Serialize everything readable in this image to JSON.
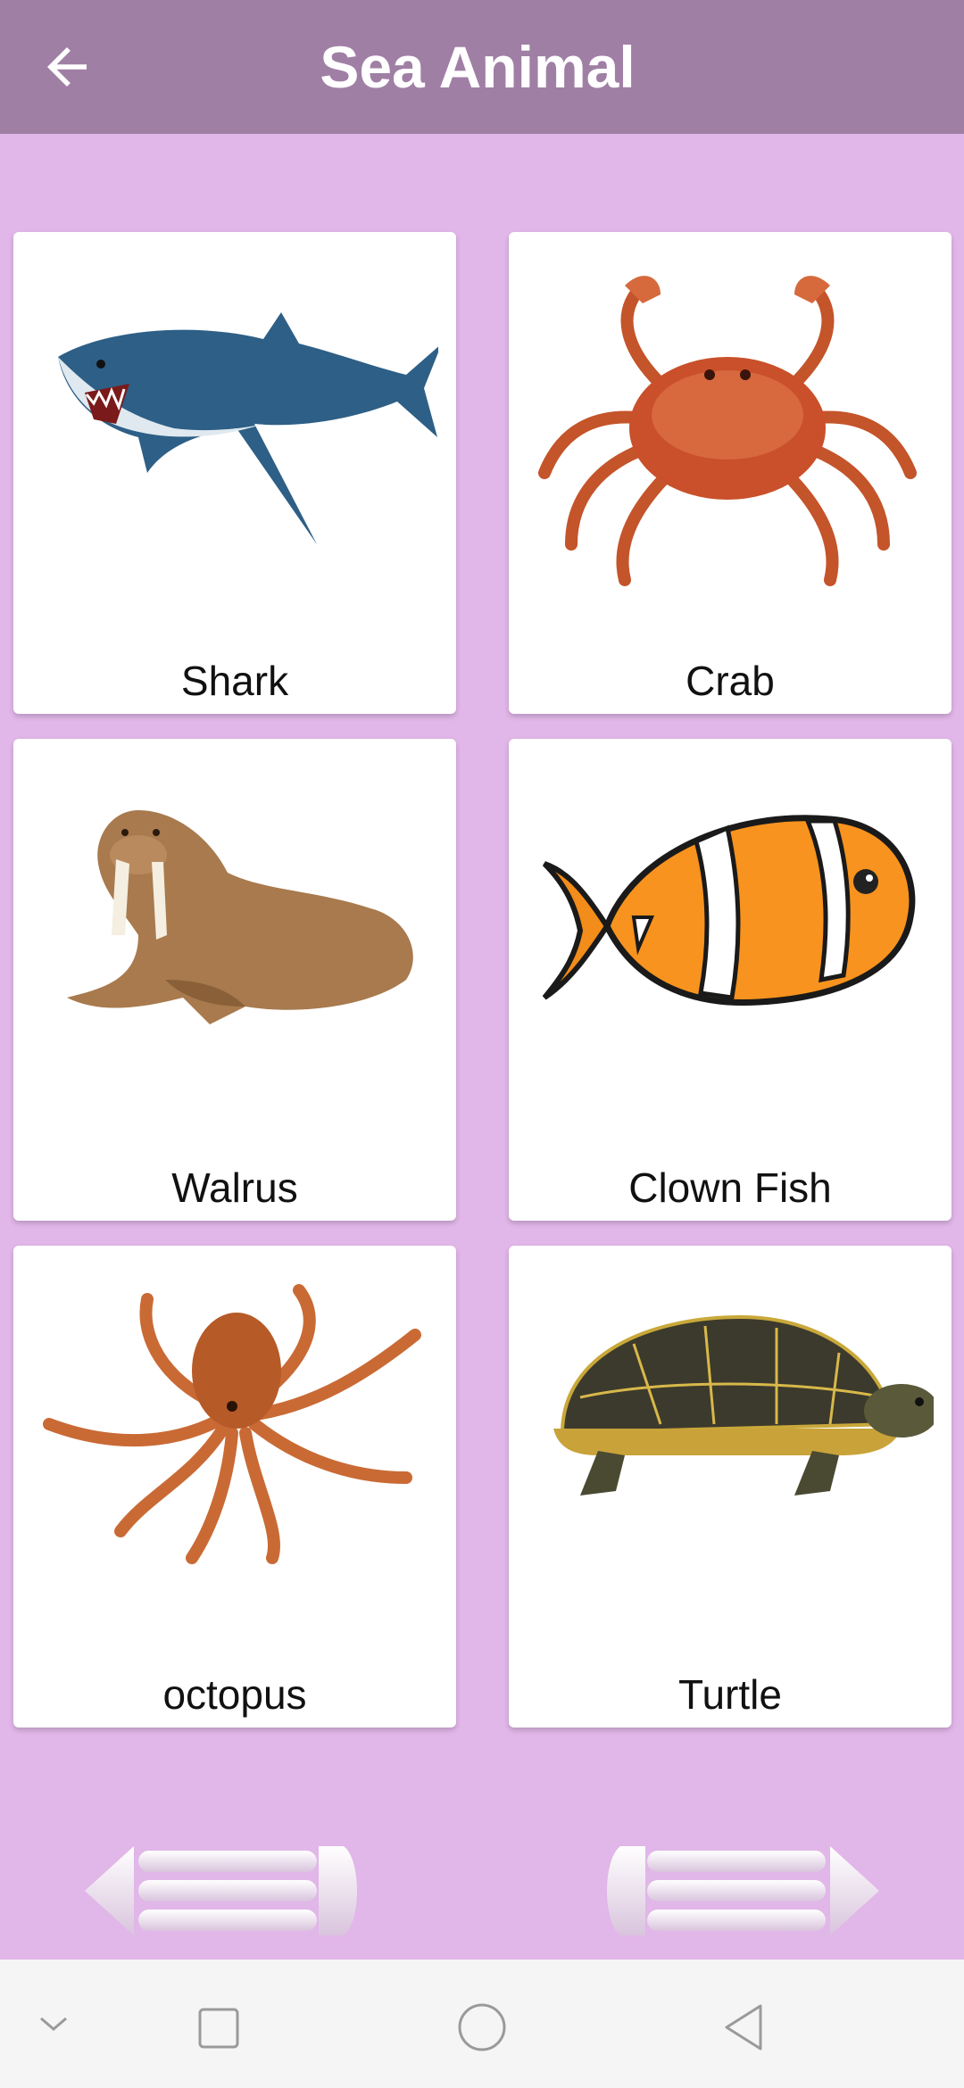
{
  "appbar": {
    "title": "Sea Animal",
    "back_icon": "arrow-left-icon",
    "background": "#a07fa5"
  },
  "page": {
    "background": "#e1b6e8"
  },
  "animals": [
    {
      "label": "Shark",
      "image": "shark-image"
    },
    {
      "label": "Crab",
      "image": "crab-image"
    },
    {
      "label": "Walrus",
      "image": "walrus-image"
    },
    {
      "label": "Clown Fish",
      "image": "clownfish-image"
    },
    {
      "label": "octopus",
      "image": "octopus-image"
    },
    {
      "label": "Turtle",
      "image": "turtle-image"
    }
  ],
  "pager": {
    "previous_icon": "previous-arrow-icon",
    "next_icon": "next-arrow-icon"
  },
  "system_nav": {
    "icons": [
      "chevron-down-icon",
      "recents-square-icon",
      "home-circle-icon",
      "back-triangle-icon"
    ]
  }
}
